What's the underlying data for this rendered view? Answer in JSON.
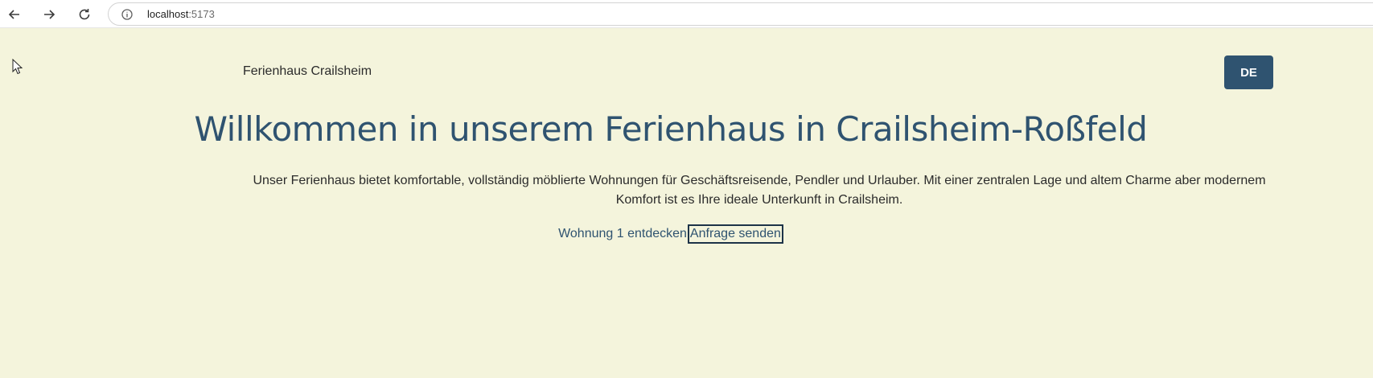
{
  "browser": {
    "url_host": "localhost",
    "url_port": ":5173",
    "icons": {
      "back": "arrow-left-icon",
      "forward": "arrow-right-icon",
      "reload": "reload-icon",
      "site_info": "info-circle-icon"
    }
  },
  "header": {
    "brand": "Ferienhaus Crailsheim",
    "language_button": "DE"
  },
  "hero": {
    "title": "Willkommen in unserem Ferienhaus in Crailsheim-Roßfeld",
    "description": "Unser Ferienhaus bietet komfortable, vollständig möblierte Wohnungen für Geschäftsreisende, Pendler und Urlauber. Mit einer zentralen Lage und altem Charme aber modernem Komfort ist es Ihre ideale Unterkunft in Crailsheim.",
    "links": {
      "discover": "Wohnung 1 entdecken",
      "inquiry": "Anfrage senden"
    }
  },
  "colors": {
    "page_background": "#f4f4dc",
    "accent": "#2f5370",
    "text": "#2b2b2b"
  }
}
